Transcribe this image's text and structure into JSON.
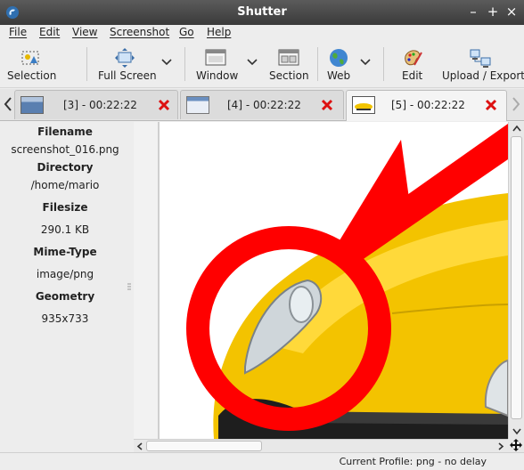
{
  "window": {
    "title": "Shutter"
  },
  "menu": {
    "items": [
      "File",
      "Edit",
      "View",
      "Screenshot",
      "Go",
      "Help"
    ]
  },
  "toolbar": {
    "selection": "Selection",
    "full_screen": "Full Screen",
    "window": "Window",
    "section": "Section",
    "web": "Web",
    "edit": "Edit",
    "upload_export": "Upload / Export"
  },
  "tabs": [
    {
      "label": "[3] - 00:22:22"
    },
    {
      "label": "[4] - 00:22:22"
    },
    {
      "label": "[5] - 00:22:22"
    }
  ],
  "sidebar": {
    "filename_label": "Filename",
    "filename": "screenshot_016.png",
    "directory_label": "Directory",
    "directory": "/home/mario",
    "filesize_label": "Filesize",
    "filesize": "290.1 KB",
    "mime_label": "Mime-Type",
    "mime": "image/png",
    "geometry_label": "Geometry",
    "geometry": "935x733"
  },
  "status": {
    "text": "Current Profile: png - no delay"
  },
  "colors": {
    "annotation_red": "#ff0000",
    "car_yellow": "#f2c400",
    "titlebar": "#3a3a3a"
  }
}
